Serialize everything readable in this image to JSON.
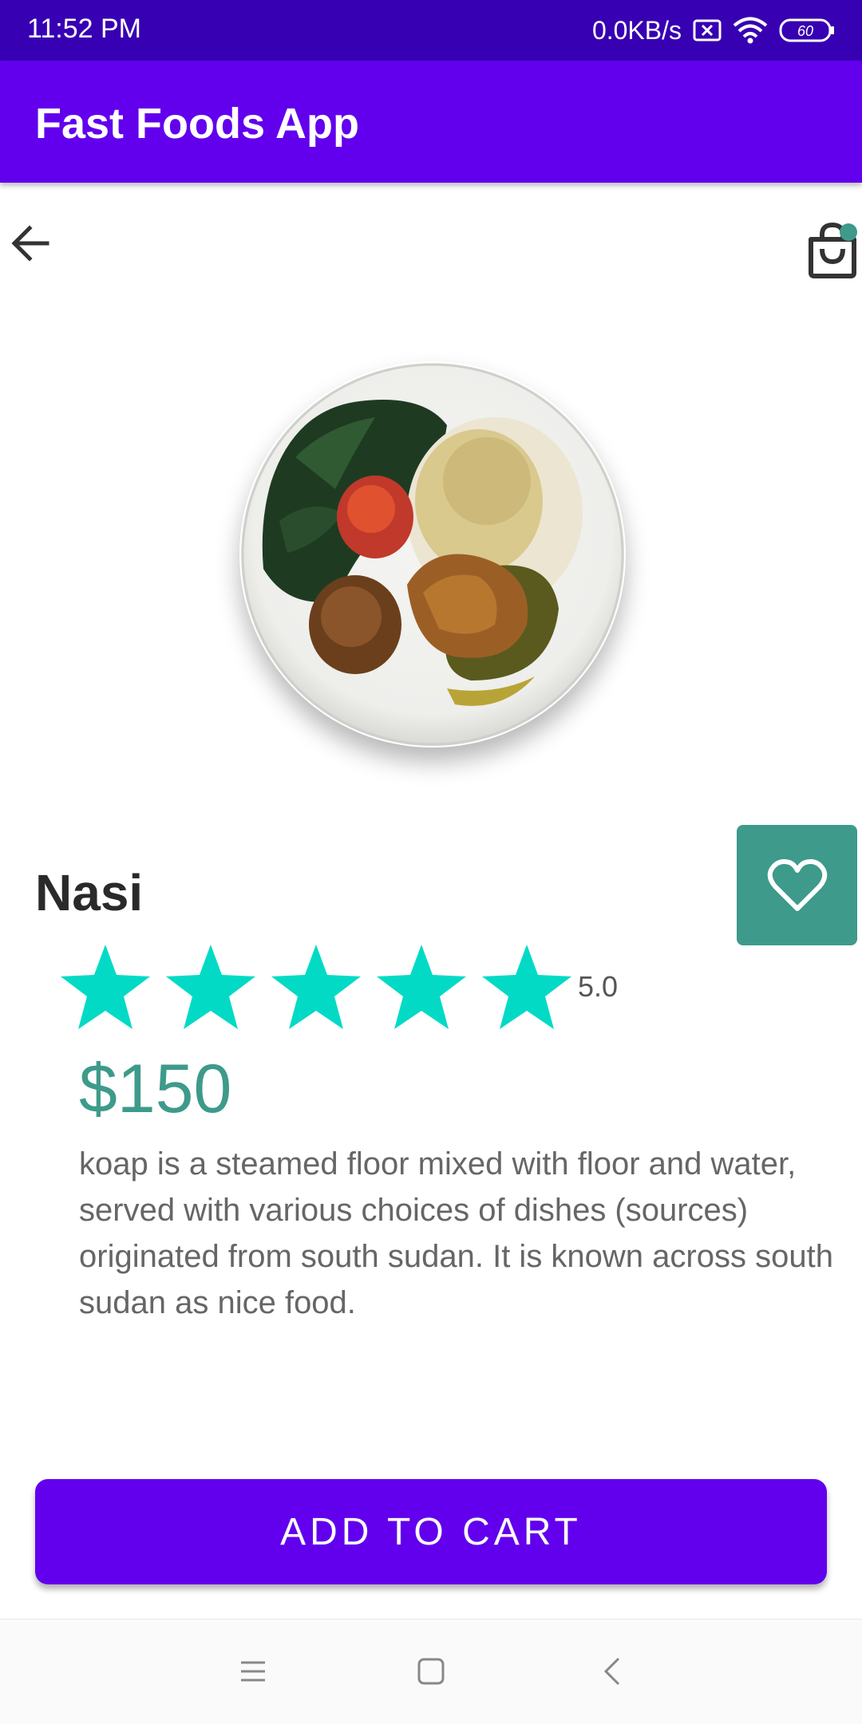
{
  "status_bar": {
    "time": "11:52 PM",
    "net_speed": "0.0KB/s",
    "battery": "60"
  },
  "app_bar": {
    "title": "Fast Foods App"
  },
  "toolbar": {
    "back_icon": "arrow-left-icon",
    "cart_icon": "shopping-bag-icon"
  },
  "product": {
    "name": "Nasi",
    "rating": "5.0",
    "stars_filled": 5,
    "stars_total": 5,
    "price": "$150",
    "description": "koap is a steamed floor mixed with floor and water, served with various choices of dishes (sources) originated from south sudan. It is known across south sudan as nice food."
  },
  "actions": {
    "add_to_cart": "ADD TO CART",
    "favorite_icon": "heart-icon"
  },
  "colors": {
    "primary": "#6200ee",
    "primary_dark": "#3700b3",
    "accent": "#3e9a8a",
    "star": "#03dac5"
  },
  "nav": {
    "menu_icon": "menu-icon",
    "home_icon": "square-icon",
    "back_icon": "chevron-left-icon"
  }
}
